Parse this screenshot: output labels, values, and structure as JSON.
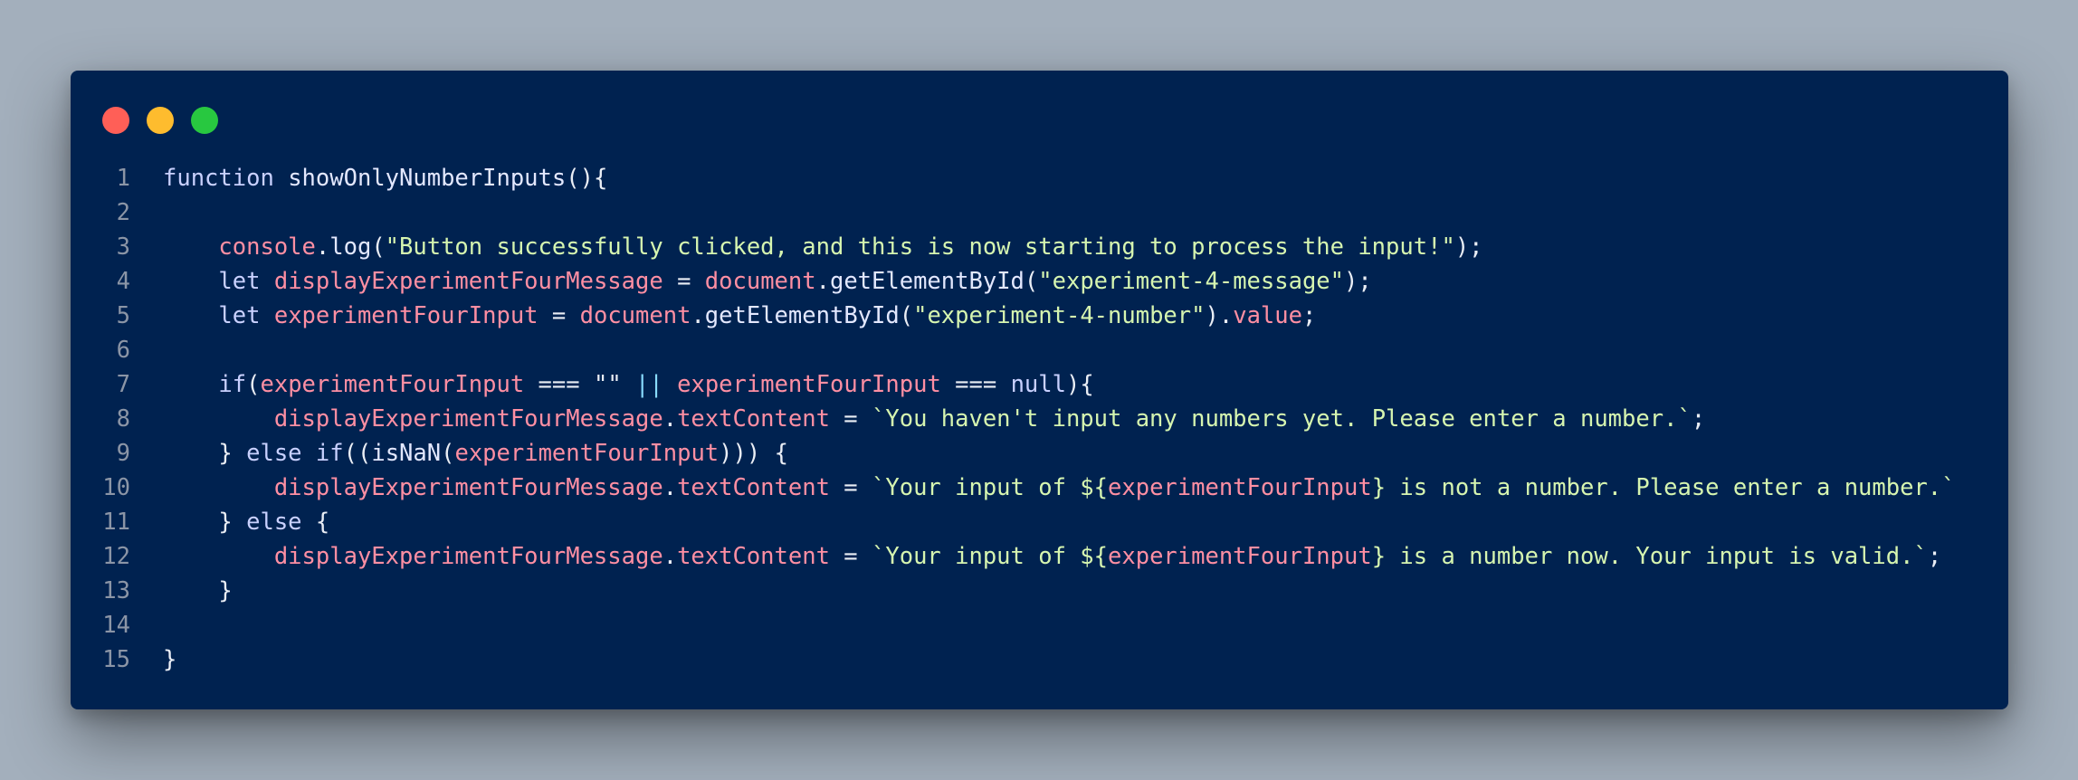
{
  "window": {
    "controls": [
      {
        "name": "close",
        "color": "#ff5f57"
      },
      {
        "name": "minimize",
        "color": "#febc2e"
      },
      {
        "name": "maximize",
        "color": "#28c840"
      }
    ]
  },
  "code": {
    "language": "javascript",
    "lines": [
      {
        "num": "1",
        "tokens": [
          [
            "kw",
            "function"
          ],
          [
            "pn",
            " "
          ],
          [
            "fn",
            "showOnlyNumberInputs"
          ],
          [
            "pn",
            "(){"
          ]
        ]
      },
      {
        "num": "2",
        "tokens": []
      },
      {
        "num": "3",
        "tokens": [
          [
            "pn",
            "    "
          ],
          [
            "var",
            "console"
          ],
          [
            "pn",
            "."
          ],
          [
            "fn",
            "log"
          ],
          [
            "pn",
            "("
          ],
          [
            "str",
            "\"Button successfully clicked, and this is now starting to process the input!\""
          ],
          [
            "pn",
            ");"
          ]
        ]
      },
      {
        "num": "4",
        "tokens": [
          [
            "pn",
            "    "
          ],
          [
            "kw",
            "let"
          ],
          [
            "pn",
            " "
          ],
          [
            "var",
            "displayExperimentFourMessage"
          ],
          [
            "pn",
            " = "
          ],
          [
            "var",
            "document"
          ],
          [
            "pn",
            "."
          ],
          [
            "fn",
            "getElementById"
          ],
          [
            "pn",
            "("
          ],
          [
            "str",
            "\"experiment-4-message\""
          ],
          [
            "pn",
            ");"
          ]
        ]
      },
      {
        "num": "5",
        "tokens": [
          [
            "pn",
            "    "
          ],
          [
            "kw",
            "let"
          ],
          [
            "pn",
            " "
          ],
          [
            "var",
            "experimentFourInput"
          ],
          [
            "pn",
            " = "
          ],
          [
            "var",
            "document"
          ],
          [
            "pn",
            "."
          ],
          [
            "fn",
            "getElementById"
          ],
          [
            "pn",
            "("
          ],
          [
            "str",
            "\"experiment-4-number\""
          ],
          [
            "pn",
            ")."
          ],
          [
            "var",
            "value"
          ],
          [
            "pn",
            ";"
          ]
        ]
      },
      {
        "num": "6",
        "tokens": []
      },
      {
        "num": "7",
        "tokens": [
          [
            "pn",
            "    "
          ],
          [
            "kw",
            "if"
          ],
          [
            "pn",
            "("
          ],
          [
            "var",
            "experimentFourInput"
          ],
          [
            "pn",
            " === \"\" "
          ],
          [
            "op",
            "||"
          ],
          [
            "pn",
            " "
          ],
          [
            "var",
            "experimentFourInput"
          ],
          [
            "pn",
            " === "
          ],
          [
            "kw",
            "null"
          ],
          [
            "pn",
            "){"
          ]
        ]
      },
      {
        "num": "8",
        "tokens": [
          [
            "pn",
            "        "
          ],
          [
            "var",
            "displayExperimentFourMessage"
          ],
          [
            "pn",
            "."
          ],
          [
            "var",
            "textContent"
          ],
          [
            "pn",
            " = "
          ],
          [
            "str",
            "`You haven't input any numbers yet. Please enter a number.`"
          ],
          [
            "pn",
            ";"
          ]
        ]
      },
      {
        "num": "9",
        "tokens": [
          [
            "pn",
            "    } "
          ],
          [
            "kw",
            "else"
          ],
          [
            "pn",
            " "
          ],
          [
            "kw",
            "if"
          ],
          [
            "pn",
            "(("
          ],
          [
            "fn",
            "isNaN"
          ],
          [
            "pn",
            "("
          ],
          [
            "var",
            "experimentFourInput"
          ],
          [
            "pn",
            "))) {"
          ]
        ]
      },
      {
        "num": "10",
        "tokens": [
          [
            "pn",
            "        "
          ],
          [
            "var",
            "displayExperimentFourMessage"
          ],
          [
            "pn",
            "."
          ],
          [
            "var",
            "textContent"
          ],
          [
            "pn",
            " = "
          ],
          [
            "str",
            "`Your input of ${"
          ],
          [
            "var",
            "experimentFourInput"
          ],
          [
            "str",
            "} is not a number. Please enter a number.`"
          ]
        ]
      },
      {
        "num": "11",
        "tokens": [
          [
            "pn",
            "    } "
          ],
          [
            "kw",
            "else"
          ],
          [
            "pn",
            " {"
          ]
        ]
      },
      {
        "num": "12",
        "tokens": [
          [
            "pn",
            "        "
          ],
          [
            "var",
            "displayExperimentFourMessage"
          ],
          [
            "pn",
            "."
          ],
          [
            "var",
            "textContent"
          ],
          [
            "pn",
            " = "
          ],
          [
            "str",
            "`Your input of ${"
          ],
          [
            "var",
            "experimentFourInput"
          ],
          [
            "str",
            "} is a number now. Your input is valid.`"
          ],
          [
            "pn",
            ";"
          ]
        ]
      },
      {
        "num": "13",
        "tokens": [
          [
            "pn",
            "    }"
          ]
        ]
      },
      {
        "num": "14",
        "tokens": []
      },
      {
        "num": "15",
        "tokens": [
          [
            "pn",
            "}"
          ]
        ]
      }
    ]
  }
}
